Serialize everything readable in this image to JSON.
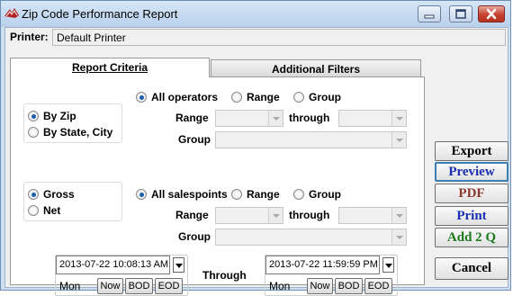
{
  "window": {
    "title": "Zip Code Performance Report"
  },
  "printer": {
    "label": "Printer:",
    "value": "Default Printer"
  },
  "tabs": [
    {
      "label": "Report Criteria",
      "active": true
    },
    {
      "label": "Additional Filters",
      "active": false
    }
  ],
  "grouping": {
    "options": [
      "By Zip",
      "By State, City"
    ],
    "selected": "By Zip"
  },
  "amount": {
    "options": [
      "Gross",
      "Net"
    ],
    "selected": "Gross"
  },
  "operators": {
    "options": [
      "All operators",
      "Range",
      "Group"
    ],
    "selected": "All operators",
    "range_label": "Range",
    "through_label": "through",
    "group_label": "Group",
    "range_from": "",
    "range_to": "",
    "group_value": ""
  },
  "salespoints": {
    "options": [
      "All salespoints",
      "Range",
      "Group"
    ],
    "selected": "All salespoints",
    "range_label": "Range",
    "through_label": "through",
    "group_label": "Group",
    "range_from": "",
    "range_to": "",
    "group_value": ""
  },
  "date_range": {
    "start": {
      "value": "2013-07-22 10:08:13 AM",
      "day": "Mon"
    },
    "through_label": "Through",
    "end": {
      "value": "2013-07-22 11:59:59 PM",
      "day": "Mon"
    },
    "buttons": [
      "Now",
      "BOD",
      "EOD"
    ]
  },
  "actions": [
    {
      "label": "Export",
      "color": "#000000"
    },
    {
      "label": "Preview",
      "color": "#1a2fb0"
    },
    {
      "label": "PDF",
      "color": "#8a3a30"
    },
    {
      "label": "Print",
      "color": "#1a2fb0"
    },
    {
      "label": "Add 2 Q",
      "color": "#1f7a1f"
    },
    {
      "label": "Cancel",
      "color": "#000000"
    }
  ],
  "colors": {
    "title_bar": "#c8dbf0",
    "close_button": "#c5412f",
    "radio_selected": "#1d5fa8"
  }
}
